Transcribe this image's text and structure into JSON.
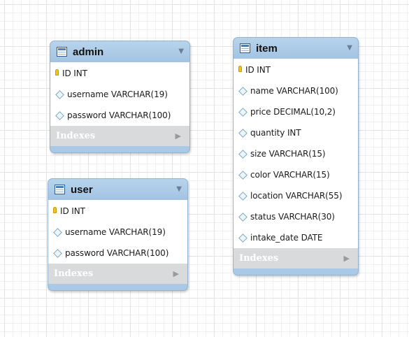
{
  "diagram": {
    "colors": {
      "header": "#a9c9e6",
      "indexes_bar": "#d9dadc",
      "key_icon": "#f0c419",
      "grid": "#e3e3e3"
    },
    "tables": [
      {
        "id": "admin",
        "name": "admin",
        "header_icon": "table-icon",
        "collapse_icon": "triangle-down-icon",
        "fields": [
          {
            "icon": "key-icon",
            "text": "ID INT"
          },
          {
            "icon": "diamond-icon",
            "text": "username VARCHAR(19)"
          },
          {
            "icon": "diamond-icon",
            "text": "password VARCHAR(100)"
          }
        ],
        "indexes_label": "Indexes",
        "indexes_icon": "triangle-right-icon"
      },
      {
        "id": "user",
        "name": "user",
        "header_icon": "table-icon",
        "collapse_icon": "triangle-down-icon",
        "fields": [
          {
            "icon": "key-icon",
            "text": "ID INT"
          },
          {
            "icon": "diamond-icon",
            "text": "username VARCHAR(19)"
          },
          {
            "icon": "diamond-icon",
            "text": "password VARCHAR(100)"
          }
        ],
        "indexes_label": "Indexes",
        "indexes_icon": "triangle-right-icon"
      },
      {
        "id": "item",
        "name": "item",
        "header_icon": "table-icon",
        "collapse_icon": "triangle-down-icon",
        "fields": [
          {
            "icon": "key-icon",
            "text": "ID INT"
          },
          {
            "icon": "diamond-icon",
            "text": "name VARCHAR(100)"
          },
          {
            "icon": "diamond-icon",
            "text": "price DECIMAL(10,2)"
          },
          {
            "icon": "diamond-icon",
            "text": "quantity INT"
          },
          {
            "icon": "diamond-icon",
            "text": "size VARCHAR(15)"
          },
          {
            "icon": "diamond-icon",
            "text": "color VARCHAR(15)"
          },
          {
            "icon": "diamond-icon",
            "text": "location VARCHAR(55)"
          },
          {
            "icon": "diamond-icon",
            "text": "status VARCHAR(30)"
          },
          {
            "icon": "diamond-icon",
            "text": "intake_date DATE"
          }
        ],
        "indexes_label": "Indexes",
        "indexes_icon": "triangle-right-icon"
      }
    ]
  }
}
